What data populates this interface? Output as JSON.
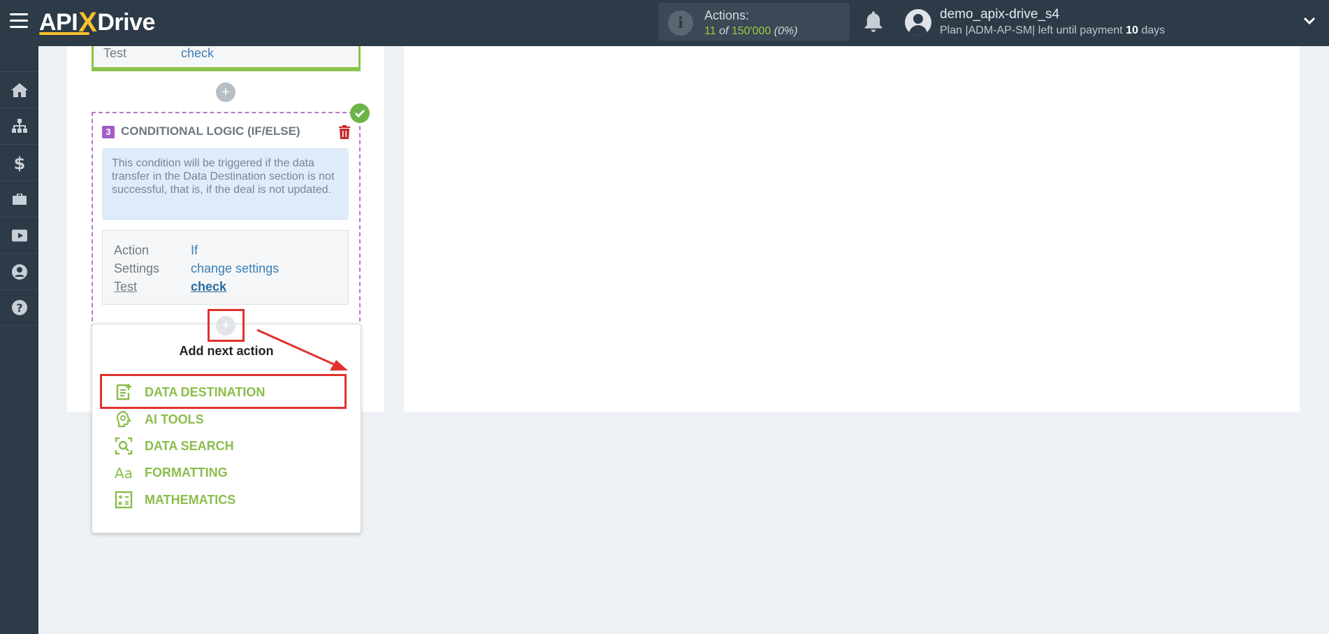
{
  "header": {
    "logo": {
      "left": "API",
      "x": "X",
      "right": "Drive"
    },
    "actions_label": "Actions:",
    "actions_current": "11",
    "actions_of": "of",
    "actions_limit": "150'000",
    "actions_percent": "(0%)",
    "user_name": "demo_apix-drive_s4",
    "plan_prefix": "Plan |ADM-AP-SM| left until payment",
    "plan_days": "10",
    "plan_suffix": "days"
  },
  "sidebar": {
    "items": [
      {
        "icon": "home-icon"
      },
      {
        "icon": "sitemap-icon"
      },
      {
        "icon": "dollar-icon"
      },
      {
        "icon": "briefcase-icon"
      },
      {
        "icon": "youtube-icon"
      },
      {
        "icon": "user-circle-icon"
      },
      {
        "icon": "question-circle-icon"
      }
    ]
  },
  "prev_card": {
    "label": "Test",
    "value": "check"
  },
  "logic_card": {
    "step": "3",
    "title": "CONDITIONAL LOGIC (IF/ELSE)",
    "note": "This condition will be triggered if the data transfer in the Data Destination section is not successful, that is, if the deal is not updated.",
    "rows": [
      {
        "label": "Action",
        "value": "If"
      },
      {
        "label": "Settings",
        "value": "change settings"
      },
      {
        "label": "Test",
        "value": "check"
      }
    ]
  },
  "dropdown": {
    "title": "Add next action",
    "items": [
      {
        "label": "DATA DESTINATION",
        "icon": "data-destination-icon"
      },
      {
        "label": "AI TOOLS",
        "icon": "ai-tools-icon"
      },
      {
        "label": "DATA SEARCH",
        "icon": "data-search-icon"
      },
      {
        "label": "FORMATTING",
        "icon": "formatting-icon"
      },
      {
        "label": "MATHEMATICS",
        "icon": "mathematics-icon"
      }
    ]
  },
  "colors": {
    "topbar": "#2d3a47",
    "accent_green": "#8bbd4b",
    "link_blue": "#3b7fb6",
    "highlight_red": "#e0322f",
    "logic_purple": "#a35cc4"
  }
}
